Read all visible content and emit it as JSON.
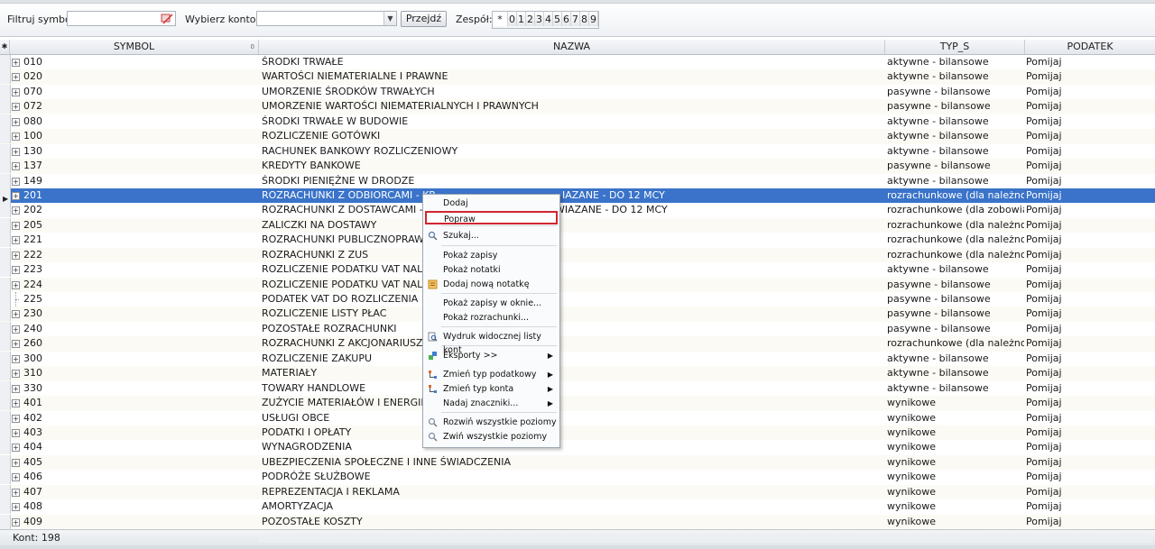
{
  "toolbar": {
    "filter_label": "Filtruj symbol",
    "filter_value": "",
    "account_label": "Wybierz konto:",
    "account_value": "",
    "go_label": "Przejdź",
    "team_label": "Zespół:",
    "team_options": [
      "*",
      "0",
      "1",
      "2",
      "3",
      "4",
      "5",
      "6",
      "7",
      "8",
      "9"
    ]
  },
  "grid": {
    "columns": {
      "symbol": "SYMBOL",
      "symbol_sort": "0",
      "nazwa": "NAZWA",
      "typ": "TYP_S",
      "podatek": "PODATEK"
    },
    "rows": [
      {
        "symbol": "010",
        "nazwa": "ŚRODKI TRWAŁE",
        "typ": "aktywne - bilansowe",
        "podatek": "Pomijaj",
        "expandable": true
      },
      {
        "symbol": "020",
        "nazwa": "WARTOŚCI NIEMATERIALNE I PRAWNE",
        "typ": "aktywne - bilansowe",
        "podatek": "Pomijaj",
        "expandable": true
      },
      {
        "symbol": "070",
        "nazwa": "UMORZENIE ŚRODKÓW TRWAŁYCH",
        "typ": "pasywne - bilansowe",
        "podatek": "Pomijaj",
        "expandable": true
      },
      {
        "symbol": "072",
        "nazwa": "UMORZENIE WARTOŚCI NIEMATERIALNYCH I PRAWNYCH",
        "typ": "pasywne - bilansowe",
        "podatek": "Pomijaj",
        "expandable": true
      },
      {
        "symbol": "080",
        "nazwa": "ŚRODKI TRWAŁE W BUDOWIE",
        "typ": "aktywne - bilansowe",
        "podatek": "Pomijaj",
        "expandable": true
      },
      {
        "symbol": "100",
        "nazwa": "ROZLICZENIE GOTÓWKI",
        "typ": "aktywne - bilansowe",
        "podatek": "Pomijaj",
        "expandable": true
      },
      {
        "symbol": "130",
        "nazwa": "RACHUNEK BANKOWY ROZLICZENIOWY",
        "typ": "aktywne - bilansowe",
        "podatek": "Pomijaj",
        "expandable": true
      },
      {
        "symbol": "137",
        "nazwa": "KREDYTY BANKOWE",
        "typ": "pasywne - bilansowe",
        "podatek": "Pomijaj",
        "expandable": true
      },
      {
        "symbol": "149",
        "nazwa": "ŚRODKI PIENIĘŻNE W DRODZE",
        "typ": "aktywne - bilansowe",
        "podatek": "Pomijaj",
        "expandable": true
      },
      {
        "symbol": "201",
        "nazwa": "ROZRACHUNKI Z ODBIORCAMI - KR",
        "nazwa_tail": "IAZANE - DO 12 MCY",
        "typ": "rozrachunkowe (dla należności)",
        "podatek": "Pomijaj",
        "expandable": true,
        "selected": true
      },
      {
        "symbol": "202",
        "nazwa": "ROZRACHUNKI Z DOSTAWCAMI - K",
        "nazwa_tail": "WIAZANE - DO 12 MCY",
        "typ": "rozrachunkowe (dla zobowiązań)",
        "podatek": "Pomijaj",
        "expandable": true
      },
      {
        "symbol": "205",
        "nazwa": "ZALICZKI NA DOSTAWY",
        "typ": "rozrachunkowe (dla należności)",
        "podatek": "Pomijaj",
        "expandable": true
      },
      {
        "symbol": "221",
        "nazwa": "ROZRACHUNKI PUBLICZNOPRAWNE",
        "typ": "rozrachunkowe (dla należności)",
        "podatek": "Pomijaj",
        "expandable": true
      },
      {
        "symbol": "222",
        "nazwa": "ROZRACHUNKI Z ZUS",
        "typ": "rozrachunkowe (dla należności)",
        "podatek": "Pomijaj",
        "expandable": true
      },
      {
        "symbol": "223",
        "nazwa": "ROZLICZENIE PODATKU VAT NALIC",
        "typ": "aktywne - bilansowe",
        "podatek": "Pomijaj",
        "expandable": true
      },
      {
        "symbol": "224",
        "nazwa": "ROZLICZENIE PODATKU VAT NALE",
        "typ": "pasywne - bilansowe",
        "podatek": "Pomijaj",
        "expandable": true
      },
      {
        "symbol": "225",
        "nazwa": "PODATEK VAT DO ROZLICZENIA",
        "typ": "pasywne - bilansowe",
        "podatek": "Pomijaj",
        "expandable": false
      },
      {
        "symbol": "230",
        "nazwa": "ROZLICZENIE LISTY PŁAC",
        "typ": "pasywne - bilansowe",
        "podatek": "Pomijaj",
        "expandable": true
      },
      {
        "symbol": "240",
        "nazwa": "POZOSTAŁE ROZRACHUNKI",
        "typ": "pasywne - bilansowe",
        "podatek": "Pomijaj",
        "expandable": true
      },
      {
        "symbol": "260",
        "nazwa": "ROZRACHUNKI Z AKCJONARIUSZAM",
        "typ": "rozrachunkowe (dla należności)",
        "podatek": "Pomijaj",
        "expandable": true
      },
      {
        "symbol": "300",
        "nazwa": "ROZLICZENIE ZAKUPU",
        "typ": "aktywne - bilansowe",
        "podatek": "Pomijaj",
        "expandable": true
      },
      {
        "symbol": "310",
        "nazwa": "MATERIAŁY",
        "typ": "aktywne - bilansowe",
        "podatek": "Pomijaj",
        "expandable": true
      },
      {
        "symbol": "330",
        "nazwa": "TOWARY HANDLOWE",
        "typ": "aktywne - bilansowe",
        "podatek": "Pomijaj",
        "expandable": true
      },
      {
        "symbol": "401",
        "nazwa": "ZUŻYCIE MATERIAŁÓW I ENERGII",
        "typ": "wynikowe",
        "podatek": "Pomijaj",
        "expandable": true
      },
      {
        "symbol": "402",
        "nazwa": "USŁUGI OBCE",
        "typ": "wynikowe",
        "podatek": "Pomijaj",
        "expandable": true
      },
      {
        "symbol": "403",
        "nazwa": "PODATKI I OPŁATY",
        "typ": "wynikowe",
        "podatek": "Pomijaj",
        "expandable": true
      },
      {
        "symbol": "404",
        "nazwa": "WYNAGRODZENIA",
        "typ": "wynikowe",
        "podatek": "Pomijaj",
        "expandable": true
      },
      {
        "symbol": "405",
        "nazwa": "UBEZPIECZENIA SPOŁECZNE I INNE ŚWIADCZENIA",
        "typ": "wynikowe",
        "podatek": "Pomijaj",
        "expandable": true
      },
      {
        "symbol": "406",
        "nazwa": "PODRÓŻE SŁUŻBOWE",
        "typ": "wynikowe",
        "podatek": "Pomijaj",
        "expandable": true
      },
      {
        "symbol": "407",
        "nazwa": "REPREZENTACJA I REKLAMA",
        "typ": "wynikowe",
        "podatek": "Pomijaj",
        "expandable": true
      },
      {
        "symbol": "408",
        "nazwa": "AMORTYZACJA",
        "typ": "wynikowe",
        "podatek": "Pomijaj",
        "expandable": true
      },
      {
        "symbol": "409",
        "nazwa": "POZOSTAŁE KOSZTY",
        "typ": "wynikowe",
        "podatek": "Pomijaj",
        "expandable": true
      }
    ]
  },
  "footer": {
    "count_label": "Kont: 198"
  },
  "context_menu": {
    "items": [
      {
        "label": "Dodaj",
        "icon": "",
        "submenu": false
      },
      {
        "label": "Popraw",
        "icon": "",
        "submenu": false,
        "highlighted": true
      },
      {
        "label": "Szukaj...",
        "icon": "magnifier-icon",
        "submenu": false
      },
      {
        "label": "Pokaż zapisy",
        "icon": "",
        "submenu": false
      },
      {
        "label": "Pokaż notatki",
        "icon": "",
        "submenu": false
      },
      {
        "label": "Dodaj nową notatkę",
        "icon": "note-icon",
        "submenu": false
      },
      {
        "label": "Pokaż zapisy w oknie...",
        "icon": "",
        "submenu": false
      },
      {
        "label": "Pokaż rozrachunki...",
        "icon": "",
        "submenu": false
      },
      {
        "label": "Wydruk widocznej listy kont",
        "icon": "print-preview-icon",
        "submenu": false
      },
      {
        "label": "Eksporty >>",
        "icon": "export-icon",
        "submenu": true
      },
      {
        "label": "Zmień typ podatkowy",
        "icon": "change-type-icon",
        "submenu": true
      },
      {
        "label": "Zmień typ konta",
        "icon": "change-type-icon",
        "submenu": true
      },
      {
        "label": "Nadaj znaczniki...",
        "icon": "",
        "submenu": true
      },
      {
        "label": "Rozwiń wszystkie poziomy",
        "icon": "expand-all-icon",
        "submenu": false
      },
      {
        "label": "Zwiń wszystkie poziomy",
        "icon": "collapse-all-icon",
        "submenu": false
      }
    ]
  },
  "colors": {
    "selection": "#3a73c9",
    "highlight_border": "#d0262d"
  }
}
